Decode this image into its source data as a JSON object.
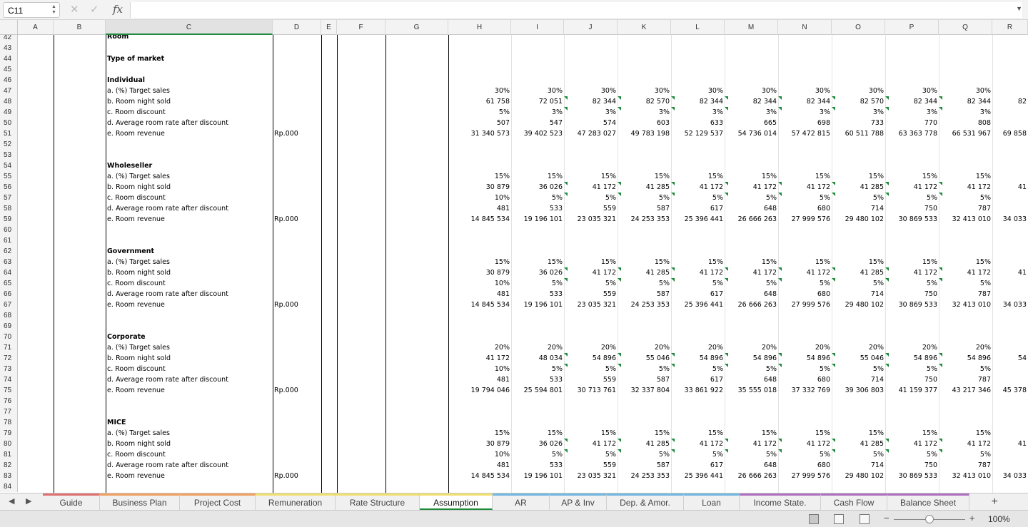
{
  "formula_bar": {
    "name_box": "C11",
    "fx": "fx",
    "formula": ""
  },
  "columns": [
    "A",
    "B",
    "C",
    "D",
    "E",
    "F",
    "G",
    "H",
    "I",
    "J",
    "K",
    "L",
    "M",
    "N",
    "O",
    "P",
    "Q",
    "R"
  ],
  "row_numbers": [
    "42",
    "43",
    "44",
    "45",
    "46",
    "47",
    "48",
    "49",
    "50",
    "51",
    "52",
    "53",
    "54",
    "55",
    "56",
    "57",
    "58",
    "59",
    "60",
    "61",
    "62",
    "63",
    "64",
    "65",
    "66",
    "67",
    "68",
    "69",
    "70",
    "71",
    "72",
    "73",
    "74",
    "75",
    "76",
    "77",
    "78",
    "79",
    "80",
    "81",
    "82",
    "83",
    "84"
  ],
  "top_label": "Room",
  "type_label": "Type of market",
  "unit": "Rp.000",
  "labels": [
    "a. (%) Target sales",
    "b. Room night sold",
    "c. Room discount",
    "d. Average room rate after discount",
    "e. Room revenue"
  ],
  "segments": [
    {
      "name": "Individual",
      "rows": [
        [
          "30%",
          "30%",
          "30%",
          "30%",
          "30%",
          "30%",
          "30%",
          "30%",
          "30%",
          "30%",
          ""
        ],
        [
          "61 758",
          "72 051",
          "82 344",
          "82 570",
          "82 344",
          "82 344",
          "82 344",
          "82 570",
          "82 344",
          "82 344",
          "82"
        ],
        [
          "5%",
          "3%",
          "3%",
          "3%",
          "3%",
          "3%",
          "3%",
          "3%",
          "3%",
          "3%",
          ""
        ],
        [
          "507",
          "547",
          "574",
          "603",
          "633",
          "665",
          "698",
          "733",
          "770",
          "808",
          ""
        ],
        [
          "31 340 573",
          "39 402 523",
          "47 283 027",
          "49 783 198",
          "52 129 537",
          "54 736 014",
          "57 472 815",
          "60 511 788",
          "63 363 778",
          "66 531 967",
          "69 858"
        ]
      ]
    },
    {
      "name": "Wholeseller",
      "rows": [
        [
          "15%",
          "15%",
          "15%",
          "15%",
          "15%",
          "15%",
          "15%",
          "15%",
          "15%",
          "15%",
          ""
        ],
        [
          "30 879",
          "36 026",
          "41 172",
          "41 285",
          "41 172",
          "41 172",
          "41 172",
          "41 285",
          "41 172",
          "41 172",
          "41"
        ],
        [
          "10%",
          "5%",
          "5%",
          "5%",
          "5%",
          "5%",
          "5%",
          "5%",
          "5%",
          "5%",
          ""
        ],
        [
          "481",
          "533",
          "559",
          "587",
          "617",
          "648",
          "680",
          "714",
          "750",
          "787",
          ""
        ],
        [
          "14 845 534",
          "19 196 101",
          "23 035 321",
          "24 253 353",
          "25 396 441",
          "26 666 263",
          "27 999 576",
          "29 480 102",
          "30 869 533",
          "32 413 010",
          "34 033"
        ]
      ]
    },
    {
      "name": "Government",
      "rows": [
        [
          "15%",
          "15%",
          "15%",
          "15%",
          "15%",
          "15%",
          "15%",
          "15%",
          "15%",
          "15%",
          ""
        ],
        [
          "30 879",
          "36 026",
          "41 172",
          "41 285",
          "41 172",
          "41 172",
          "41 172",
          "41 285",
          "41 172",
          "41 172",
          "41"
        ],
        [
          "10%",
          "5%",
          "5%",
          "5%",
          "5%",
          "5%",
          "5%",
          "5%",
          "5%",
          "5%",
          ""
        ],
        [
          "481",
          "533",
          "559",
          "587",
          "617",
          "648",
          "680",
          "714",
          "750",
          "787",
          ""
        ],
        [
          "14 845 534",
          "19 196 101",
          "23 035 321",
          "24 253 353",
          "25 396 441",
          "26 666 263",
          "27 999 576",
          "29 480 102",
          "30 869 533",
          "32 413 010",
          "34 033"
        ]
      ]
    },
    {
      "name": "Corporate",
      "rows": [
        [
          "20%",
          "20%",
          "20%",
          "20%",
          "20%",
          "20%",
          "20%",
          "20%",
          "20%",
          "20%",
          ""
        ],
        [
          "41 172",
          "48 034",
          "54 896",
          "55 046",
          "54 896",
          "54 896",
          "54 896",
          "55 046",
          "54 896",
          "54 896",
          "54"
        ],
        [
          "10%",
          "5%",
          "5%",
          "5%",
          "5%",
          "5%",
          "5%",
          "5%",
          "5%",
          "5%",
          ""
        ],
        [
          "481",
          "533",
          "559",
          "587",
          "617",
          "648",
          "680",
          "714",
          "750",
          "787",
          ""
        ],
        [
          "19 794 046",
          "25 594 801",
          "30 713 761",
          "32 337 804",
          "33 861 922",
          "35 555 018",
          "37 332 769",
          "39 306 803",
          "41 159 377",
          "43 217 346",
          "45 378"
        ]
      ]
    },
    {
      "name": "MICE",
      "rows": [
        [
          "15%",
          "15%",
          "15%",
          "15%",
          "15%",
          "15%",
          "15%",
          "15%",
          "15%",
          "15%",
          ""
        ],
        [
          "30 879",
          "36 026",
          "41 172",
          "41 285",
          "41 172",
          "41 172",
          "41 172",
          "41 285",
          "41 172",
          "41 172",
          "41"
        ],
        [
          "10%",
          "5%",
          "5%",
          "5%",
          "5%",
          "5%",
          "5%",
          "5%",
          "5%",
          "5%",
          ""
        ],
        [
          "481",
          "533",
          "559",
          "587",
          "617",
          "648",
          "680",
          "714",
          "750",
          "787",
          ""
        ],
        [
          "14 845 534",
          "19 196 101",
          "23 035 321",
          "24 253 353",
          "25 396 441",
          "26 666 263",
          "27 999 576",
          "29 480 102",
          "30 869 533",
          "32 413 010",
          "34 033"
        ]
      ]
    }
  ],
  "tabs": [
    {
      "label": "Guide",
      "color": "#e07070"
    },
    {
      "label": "Business Plan",
      "color": "#f0a060"
    },
    {
      "label": "Project Cost",
      "color": "#f0a060"
    },
    {
      "label": "Remuneration",
      "color": "#f0e070"
    },
    {
      "label": "Rate Structure",
      "color": "#f0e070"
    },
    {
      "label": "Assumption",
      "color": "#f0e070"
    },
    {
      "label": "AR",
      "color": "#70b8e0"
    },
    {
      "label": "AP & Inv",
      "color": "#70b8e0"
    },
    {
      "label": "Dep. & Amor.",
      "color": "#70b8e0"
    },
    {
      "label": "Loan",
      "color": "#70b8e0"
    },
    {
      "label": "Income State.",
      "color": "#b070c0"
    },
    {
      "label": "Cash Flow",
      "color": "#b070c0"
    },
    {
      "label": "Balance Sheet",
      "color": "#b070c0"
    }
  ],
  "active_tab": "Assumption",
  "zoom": "100%"
}
